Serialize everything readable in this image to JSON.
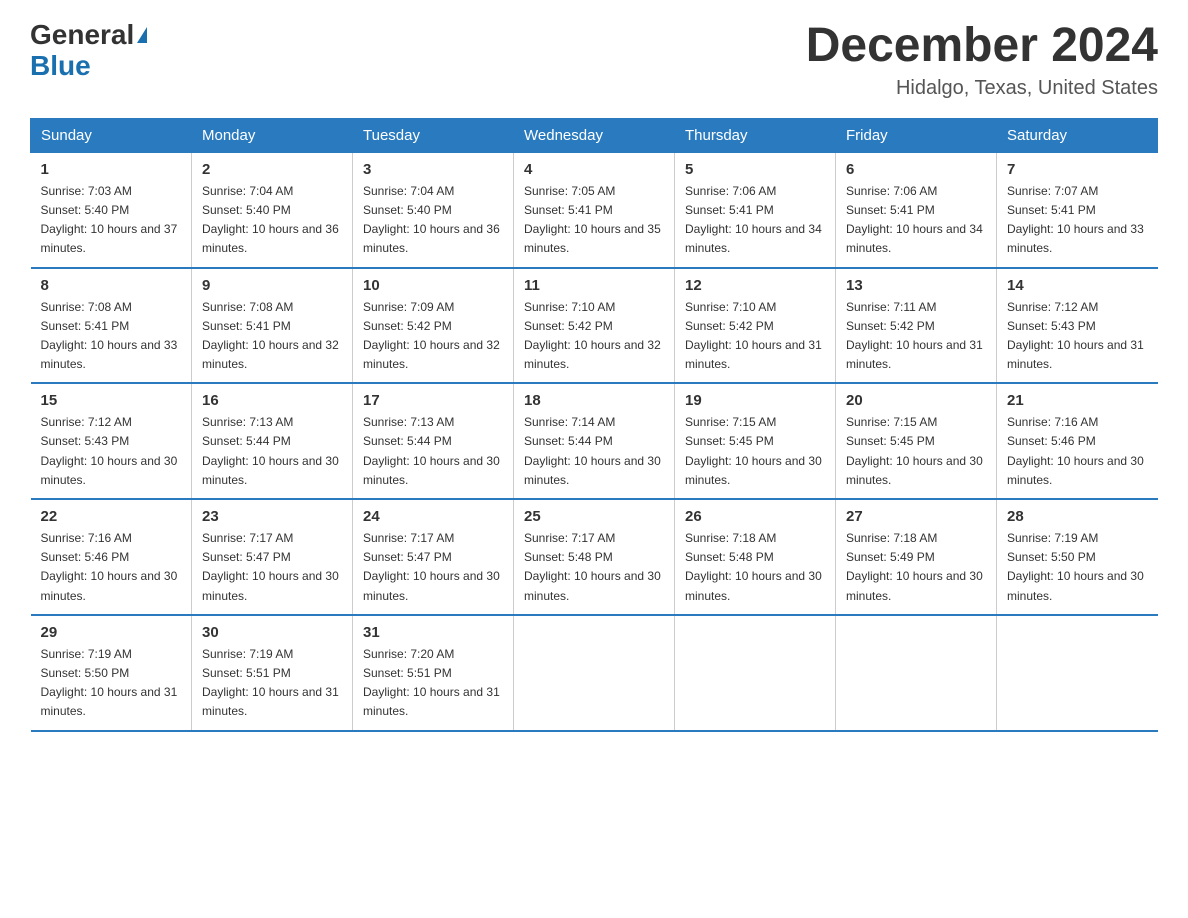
{
  "header": {
    "logo_general": "General",
    "logo_blue": "Blue",
    "month_title": "December 2024",
    "location": "Hidalgo, Texas, United States"
  },
  "days_of_week": [
    "Sunday",
    "Monday",
    "Tuesday",
    "Wednesday",
    "Thursday",
    "Friday",
    "Saturday"
  ],
  "weeks": [
    [
      {
        "day": "1",
        "sunrise": "7:03 AM",
        "sunset": "5:40 PM",
        "daylight": "10 hours and 37 minutes."
      },
      {
        "day": "2",
        "sunrise": "7:04 AM",
        "sunset": "5:40 PM",
        "daylight": "10 hours and 36 minutes."
      },
      {
        "day": "3",
        "sunrise": "7:04 AM",
        "sunset": "5:40 PM",
        "daylight": "10 hours and 36 minutes."
      },
      {
        "day": "4",
        "sunrise": "7:05 AM",
        "sunset": "5:41 PM",
        "daylight": "10 hours and 35 minutes."
      },
      {
        "day": "5",
        "sunrise": "7:06 AM",
        "sunset": "5:41 PM",
        "daylight": "10 hours and 34 minutes."
      },
      {
        "day": "6",
        "sunrise": "7:06 AM",
        "sunset": "5:41 PM",
        "daylight": "10 hours and 34 minutes."
      },
      {
        "day": "7",
        "sunrise": "7:07 AM",
        "sunset": "5:41 PM",
        "daylight": "10 hours and 33 minutes."
      }
    ],
    [
      {
        "day": "8",
        "sunrise": "7:08 AM",
        "sunset": "5:41 PM",
        "daylight": "10 hours and 33 minutes."
      },
      {
        "day": "9",
        "sunrise": "7:08 AM",
        "sunset": "5:41 PM",
        "daylight": "10 hours and 32 minutes."
      },
      {
        "day": "10",
        "sunrise": "7:09 AM",
        "sunset": "5:42 PM",
        "daylight": "10 hours and 32 minutes."
      },
      {
        "day": "11",
        "sunrise": "7:10 AM",
        "sunset": "5:42 PM",
        "daylight": "10 hours and 32 minutes."
      },
      {
        "day": "12",
        "sunrise": "7:10 AM",
        "sunset": "5:42 PM",
        "daylight": "10 hours and 31 minutes."
      },
      {
        "day": "13",
        "sunrise": "7:11 AM",
        "sunset": "5:42 PM",
        "daylight": "10 hours and 31 minutes."
      },
      {
        "day": "14",
        "sunrise": "7:12 AM",
        "sunset": "5:43 PM",
        "daylight": "10 hours and 31 minutes."
      }
    ],
    [
      {
        "day": "15",
        "sunrise": "7:12 AM",
        "sunset": "5:43 PM",
        "daylight": "10 hours and 30 minutes."
      },
      {
        "day": "16",
        "sunrise": "7:13 AM",
        "sunset": "5:44 PM",
        "daylight": "10 hours and 30 minutes."
      },
      {
        "day": "17",
        "sunrise": "7:13 AM",
        "sunset": "5:44 PM",
        "daylight": "10 hours and 30 minutes."
      },
      {
        "day": "18",
        "sunrise": "7:14 AM",
        "sunset": "5:44 PM",
        "daylight": "10 hours and 30 minutes."
      },
      {
        "day": "19",
        "sunrise": "7:15 AM",
        "sunset": "5:45 PM",
        "daylight": "10 hours and 30 minutes."
      },
      {
        "day": "20",
        "sunrise": "7:15 AM",
        "sunset": "5:45 PM",
        "daylight": "10 hours and 30 minutes."
      },
      {
        "day": "21",
        "sunrise": "7:16 AM",
        "sunset": "5:46 PM",
        "daylight": "10 hours and 30 minutes."
      }
    ],
    [
      {
        "day": "22",
        "sunrise": "7:16 AM",
        "sunset": "5:46 PM",
        "daylight": "10 hours and 30 minutes."
      },
      {
        "day": "23",
        "sunrise": "7:17 AM",
        "sunset": "5:47 PM",
        "daylight": "10 hours and 30 minutes."
      },
      {
        "day": "24",
        "sunrise": "7:17 AM",
        "sunset": "5:47 PM",
        "daylight": "10 hours and 30 minutes."
      },
      {
        "day": "25",
        "sunrise": "7:17 AM",
        "sunset": "5:48 PM",
        "daylight": "10 hours and 30 minutes."
      },
      {
        "day": "26",
        "sunrise": "7:18 AM",
        "sunset": "5:48 PM",
        "daylight": "10 hours and 30 minutes."
      },
      {
        "day": "27",
        "sunrise": "7:18 AM",
        "sunset": "5:49 PM",
        "daylight": "10 hours and 30 minutes."
      },
      {
        "day": "28",
        "sunrise": "7:19 AM",
        "sunset": "5:50 PM",
        "daylight": "10 hours and 30 minutes."
      }
    ],
    [
      {
        "day": "29",
        "sunrise": "7:19 AM",
        "sunset": "5:50 PM",
        "daylight": "10 hours and 31 minutes."
      },
      {
        "day": "30",
        "sunrise": "7:19 AM",
        "sunset": "5:51 PM",
        "daylight": "10 hours and 31 minutes."
      },
      {
        "day": "31",
        "sunrise": "7:20 AM",
        "sunset": "5:51 PM",
        "daylight": "10 hours and 31 minutes."
      },
      null,
      null,
      null,
      null
    ]
  ]
}
